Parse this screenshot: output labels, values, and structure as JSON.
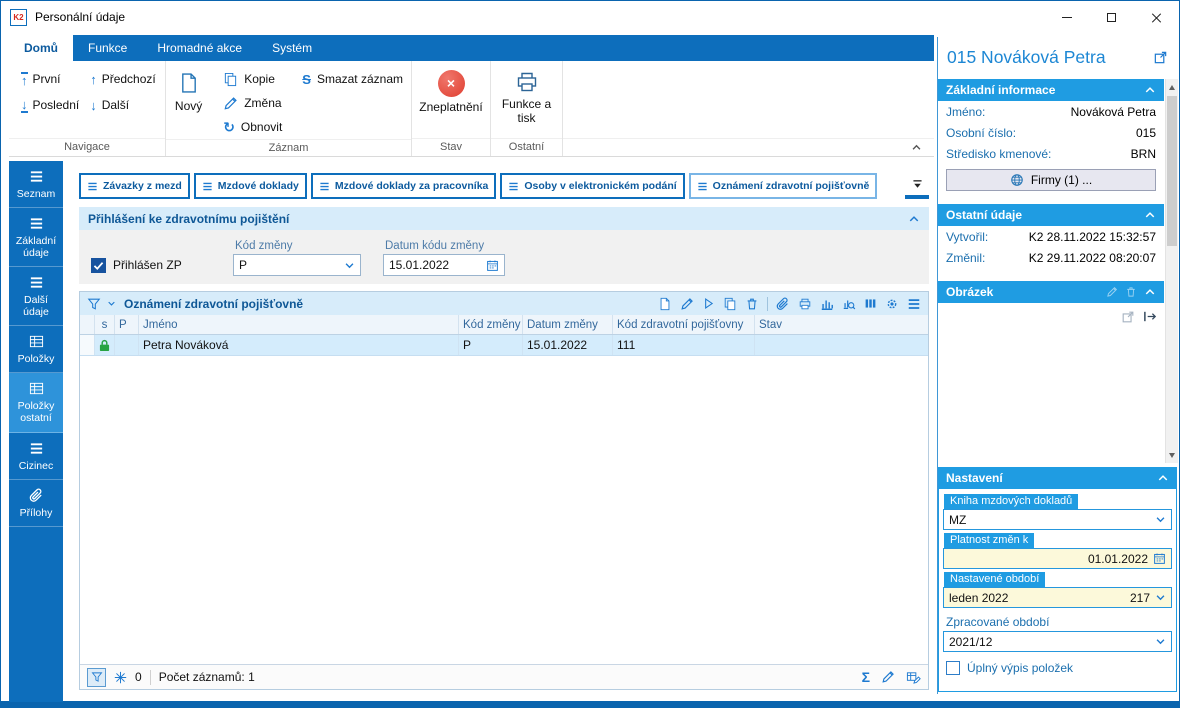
{
  "window": {
    "title": "Personální údaje",
    "logo_text": "K2"
  },
  "ribbon": {
    "tabs": [
      {
        "label": "Domů",
        "active": true
      },
      {
        "label": "Funkce",
        "active": false
      },
      {
        "label": "Hromadné akce",
        "active": false
      },
      {
        "label": "Systém",
        "active": false
      }
    ],
    "nav": {
      "first": "První",
      "last": "Poslední",
      "prev": "Předchozí",
      "next": "Další"
    },
    "record": {
      "new": "Nový",
      "copy": "Kopie",
      "change": "Změna",
      "refresh": "Obnovit",
      "delete": "Smazat záznam"
    },
    "state": {
      "invalidate": "Zneplatnění"
    },
    "other": {
      "functions_print": "Funkce a tisk"
    },
    "group_labels": {
      "navigation": "Navigace",
      "record": "Záznam",
      "state": "Stav",
      "other": "Ostatní"
    }
  },
  "sidebar": {
    "items": [
      {
        "label": "Seznam",
        "active": false
      },
      {
        "label": "Základní údaje",
        "active": false
      },
      {
        "label": "Další údaje",
        "active": false
      },
      {
        "label": "Položky",
        "active": false
      },
      {
        "label": "Položky ostatní",
        "active": true
      },
      {
        "label": "Cizinec",
        "active": false
      },
      {
        "label": "Přílohy",
        "active": false
      }
    ]
  },
  "main": {
    "tabs": [
      {
        "label": "Závazky z mezd",
        "active": false
      },
      {
        "label": "Mzdové doklady",
        "active": false
      },
      {
        "label": "Mzdové doklady za pracovníka",
        "active": false
      },
      {
        "label": "Osoby v elektronickém podání",
        "active": false
      },
      {
        "label": "Oznámení zdravotní pojišťovně",
        "active": true
      }
    ],
    "health": {
      "title": "Přihlášení ke zdravotnímu pojištění",
      "checkbox_label": "Přihlášen ZP",
      "checked": true,
      "code_label": "Kód změny",
      "code_value": "P",
      "date_label": "Datum kódu změny",
      "date_value": "15.01.2022"
    },
    "grid": {
      "title": "Oznámení zdravotní pojišťovně",
      "columns": [
        "s",
        "P",
        "Jméno",
        "Kód změny",
        "Datum změny",
        "Kód zdravotní pojišťovny",
        "Stav"
      ],
      "rows": [
        {
          "name": "Petra Nováková",
          "code": "P",
          "date": "15.01.2022",
          "insurer": "111",
          "status": ""
        }
      ],
      "footer": {
        "filter_count": "0",
        "count_label": "Počet záznamů: 1"
      }
    }
  },
  "panel": {
    "title": "015 Nováková Petra",
    "basic": {
      "title": "Základní informace",
      "rows": [
        {
          "label": "Jméno:",
          "value": "Nováková Petra"
        },
        {
          "label": "Osobní číslo:",
          "value": "015"
        },
        {
          "label": "Středisko kmenové:",
          "value": "BRN"
        }
      ],
      "firms_button": "Firmy (1) ..."
    },
    "other": {
      "title": "Ostatní údaje",
      "rows": [
        {
          "label": "Vytvořil:",
          "value": "K2 28.11.2022 15:32:57"
        },
        {
          "label": "Změnil:",
          "value": "K2 29.11.2022 08:20:07"
        }
      ]
    },
    "picture": {
      "title": "Obrázek"
    },
    "settings": {
      "title": "Nastavení",
      "book_label": "Kniha mzdových dokladů",
      "book_value": "MZ",
      "validity_label": "Platnost změn k",
      "validity_value": "01.01.2022",
      "period_label": "Nastavené období",
      "period_value": "leden 2022",
      "period_number": "217",
      "processed_label": "Zpracované období",
      "processed_value": "2021/12",
      "full_list_label": "Úplný výpis položek",
      "full_list_checked": false
    }
  },
  "icons": {
    "arrow_up": "↑",
    "arrow_down": "↓",
    "refresh": "↻",
    "cross": "×",
    "sum": "Σ",
    "delete_s": "S"
  },
  "colors": {
    "ribbon_blue": "#0d6ebc",
    "panel_header_blue": "#1f9ce2",
    "section_header_bg": "#d7ecfa",
    "selected_row_bg": "#d4ecfc",
    "invalid_red": "#df3e30",
    "active_sidebar": "#2e93da"
  }
}
